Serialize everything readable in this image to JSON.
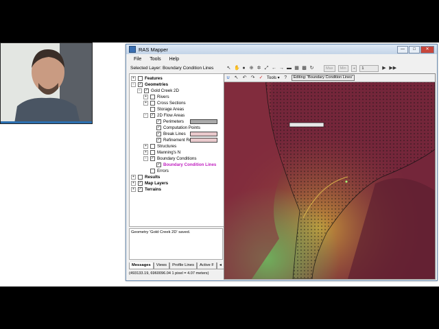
{
  "window": {
    "title": "RAS Mapper",
    "controls": [
      "—",
      "□",
      "✕"
    ]
  },
  "menu": [
    "File",
    "Tools",
    "Help"
  ],
  "selected_layer": "Selected Layer: Boundary Condition Lines",
  "toolbar": {
    "max_label": "Max",
    "min_label": "Min",
    "frame_value": "1"
  },
  "map_toolbar": {
    "tools_label": "Tools",
    "help_label": "?",
    "editing_label": "Editing: 'Boundary Condition Lines'"
  },
  "tree": [
    {
      "label": "Features",
      "checked": false,
      "bold": true
    },
    {
      "label": "Geometries",
      "checked": true,
      "bold": true
    },
    {
      "label": "Gold Creek 2D",
      "checked": true,
      "bold": false
    },
    {
      "label": "Rivers",
      "checked": false,
      "bold": false
    },
    {
      "label": "Cross Sections",
      "checked": false,
      "bold": false
    },
    {
      "label": "Storage Areas",
      "checked": false,
      "bold": false
    },
    {
      "label": "2D Flow Areas",
      "checked": true,
      "bold": false
    },
    {
      "label": "Perimeters",
      "checked": true,
      "bold": false
    },
    {
      "label": "Computation Points",
      "checked": true,
      "bold": false
    },
    {
      "label": "Break Lines",
      "checked": true,
      "bold": false
    },
    {
      "label": "Refinement Regions",
      "checked": true,
      "bold": false
    },
    {
      "label": "Structures",
      "checked": false,
      "bold": false
    },
    {
      "label": "Manning's N",
      "checked": false,
      "bold": false
    },
    {
      "label": "Boundary Conditions",
      "checked": true,
      "bold": false
    },
    {
      "label": "Boundary Condition Lines",
      "checked": true,
      "bold": true
    },
    {
      "label": "Errors",
      "checked": false,
      "bold": false
    },
    {
      "label": "Results",
      "checked": false,
      "bold": true
    },
    {
      "label": "Map Layers",
      "checked": true,
      "bold": true
    },
    {
      "label": "Terrains",
      "checked": true,
      "bold": true
    }
  ],
  "colors": {
    "selected_layer_text": "#c020c0",
    "close_button": "#c8463b",
    "map_terrain": "#7a2a38"
  },
  "messages": {
    "text": "Geometry 'Gold Creek 2D' saved."
  },
  "bottom_tabs": [
    "Messages",
    "Views",
    "Profile Lines",
    "Active F"
  ],
  "status": "(493133.19, 6960096.04  1 pixel = 4.07 meters)"
}
